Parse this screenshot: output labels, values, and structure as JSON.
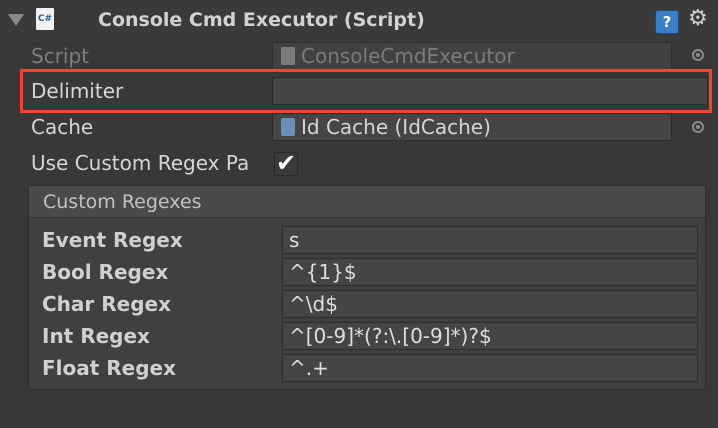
{
  "header": {
    "title": "Console Cmd Executor (Script)",
    "script_icon_label": "C#",
    "help_label": "?",
    "gear_glyph": "⚙"
  },
  "fields": {
    "script": {
      "label": "Script",
      "value": "ConsoleCmdExecutor"
    },
    "delimiter": {
      "label": "Delimiter",
      "value": ""
    },
    "cache": {
      "label": "Cache",
      "value": "Id Cache (IdCache)"
    },
    "use_custom_regex": {
      "label": "Use Custom Regex Pa",
      "checked": true,
      "check_glyph": "✔"
    }
  },
  "custom_regexes": {
    "title": "Custom Regexes",
    "rows": [
      {
        "label": "Event Regex",
        "value": "s"
      },
      {
        "label": "Bool Regex",
        "value": "^{1}$"
      },
      {
        "label": "Char Regex",
        "value": "^\\d$"
      },
      {
        "label": "Int Regex",
        "value": "^[0-9]*(?:\\.[0-9]*)?$"
      },
      {
        "label": "Float Regex",
        "value": "^.+"
      }
    ]
  },
  "colors": {
    "background": "#383838",
    "highlight": "#e84a2a",
    "help_icon": "#3d7fc4"
  }
}
